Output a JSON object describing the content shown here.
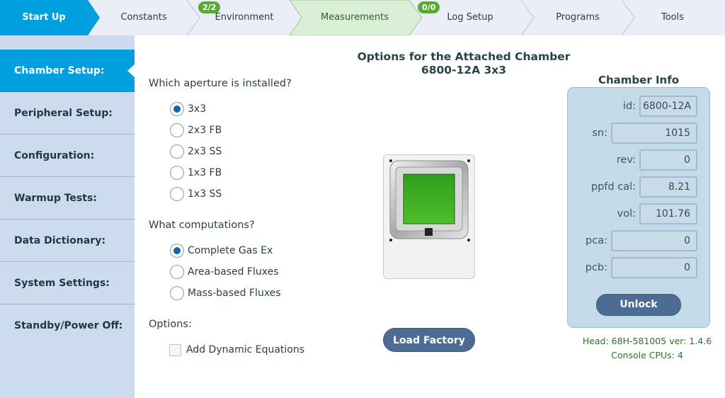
{
  "nav": {
    "tabs": [
      {
        "label": "Start Up",
        "state": "active"
      },
      {
        "label": "Constants",
        "state": "normal"
      },
      {
        "label": "Environment",
        "state": "normal",
        "badge": "2/2"
      },
      {
        "label": "Measurements",
        "state": "green"
      },
      {
        "label": "Log Setup",
        "state": "normal",
        "badge": "0/0"
      },
      {
        "label": "Programs",
        "state": "normal"
      },
      {
        "label": "Tools",
        "state": "normal"
      }
    ]
  },
  "sidebar": {
    "items": [
      {
        "label": "Chamber Setup:"
      },
      {
        "label": "Peripheral Setup:"
      },
      {
        "label": "Configuration:"
      },
      {
        "label": "Warmup Tests:"
      },
      {
        "label": "Data Dictionary:"
      },
      {
        "label": "System Settings:"
      },
      {
        "label": "Standby/Power Off:"
      }
    ]
  },
  "main": {
    "title_line1": "Options for the Attached Chamber",
    "title_line2": "6800-12A 3x3",
    "aperture_question": "Which aperture is installed?",
    "aperture_options": [
      {
        "label": "3x3",
        "selected": true
      },
      {
        "label": "2x3 FB",
        "selected": false
      },
      {
        "label": "2x3 SS",
        "selected": false
      },
      {
        "label": "1x3 FB",
        "selected": false
      },
      {
        "label": "1x3 SS",
        "selected": false
      }
    ],
    "computation_question": "What computations?",
    "computation_options": [
      {
        "label": "Complete Gas Ex",
        "selected": true
      },
      {
        "label": "Area-based Fluxes",
        "selected": false
      },
      {
        "label": "Mass-based Fluxes",
        "selected": false
      }
    ],
    "options_label": "Options:",
    "dynamic_equations_label": "Add Dynamic Equations",
    "dynamic_equations_checked": false,
    "load_factory_label": "Load Factory"
  },
  "chamber_info": {
    "title": "Chamber Info",
    "fields": {
      "id": {
        "label": "id:",
        "value": "6800-12A"
      },
      "sn": {
        "label": "sn:",
        "value": "1015"
      },
      "rev": {
        "label": "rev:",
        "value": "0"
      },
      "ppfd_cal": {
        "label": "ppfd cal:",
        "value": "8.21"
      },
      "vol": {
        "label": "vol:",
        "value": "101.76"
      },
      "pca": {
        "label": "pca:",
        "value": "0"
      },
      "pcb": {
        "label": "pcb:",
        "value": "0"
      }
    },
    "unlock_label": "Unlock"
  },
  "footer": {
    "head_line": "Head: 68H-581005 ver: 1.4.6",
    "cpu_line": "Console CPUs: 4"
  },
  "colors": {
    "active_tab": "#00a0e0",
    "green_tab": "#d9efd6",
    "sidebar": "#ccdcee",
    "badge": "#5aa936",
    "button": "#4d6c93",
    "status_text": "#23762a"
  }
}
